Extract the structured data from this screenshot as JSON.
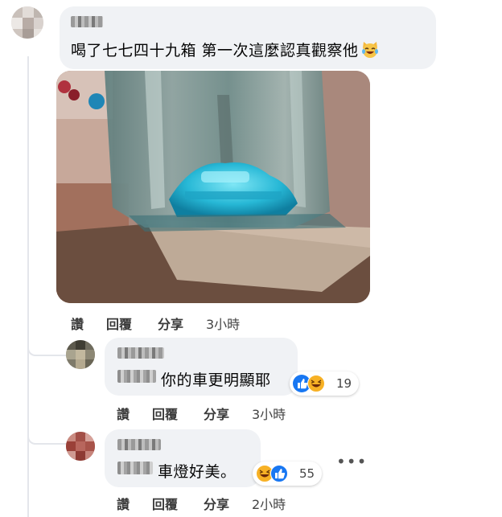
{
  "comment": {
    "text": "喝了七七四十九箱 第一次這麼認真觀察他",
    "emoji": "laughing-crying-cat-emoji",
    "actions": {
      "like": "讚",
      "reply": "回覆",
      "share": "分享",
      "time": "3小時"
    }
  },
  "replies": [
    {
      "text": "你的車更明顯耶",
      "reaction_count": "19",
      "reactions": [
        "like",
        "haha"
      ],
      "actions": {
        "like": "讚",
        "reply": "回覆",
        "share": "分享",
        "time": "3小時"
      }
    },
    {
      "text": "車燈好美。",
      "reaction_count": "55",
      "reactions": [
        "haha",
        "like"
      ],
      "actions": {
        "like": "讚",
        "reply": "回覆",
        "share": "分享",
        "time": "2小時"
      }
    }
  ],
  "more_label": "•••",
  "colors": {
    "bubble": "#f0f2f5",
    "like_blue": "#1877f2",
    "haha_yellow": "#f7b125"
  }
}
